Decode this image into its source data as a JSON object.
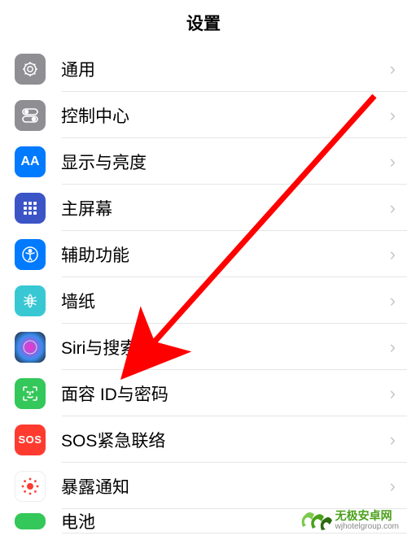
{
  "header": {
    "title": "设置"
  },
  "items": [
    {
      "label": "通用",
      "icon": "general"
    },
    {
      "label": "控制中心",
      "icon": "control-center"
    },
    {
      "label": "显示与亮度",
      "icon": "display"
    },
    {
      "label": "主屏幕",
      "icon": "home-screen"
    },
    {
      "label": "辅助功能",
      "icon": "accessibility"
    },
    {
      "label": "墙纸",
      "icon": "wallpaper"
    },
    {
      "label": "Siri与搜索",
      "icon": "siri"
    },
    {
      "label": "面容 ID与密码",
      "icon": "face-id"
    },
    {
      "label": "SOS紧急联络",
      "icon": "sos",
      "text": "SOS"
    },
    {
      "label": "暴露通知",
      "icon": "exposure"
    },
    {
      "label": "电池",
      "icon": "battery"
    }
  ],
  "watermark": {
    "name": "无极安卓网",
    "url": "wjhotelgroup.com"
  }
}
